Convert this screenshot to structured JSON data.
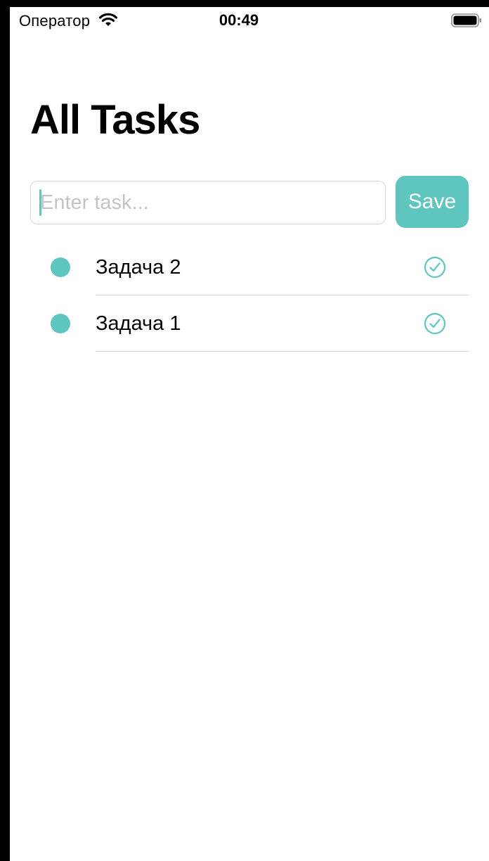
{
  "status_bar": {
    "carrier": "Оператор",
    "time": "00:49",
    "wifi_icon": "wifi-icon",
    "battery_icon": "battery-full-icon"
  },
  "header": {
    "title": "All Tasks"
  },
  "new_task": {
    "value": "",
    "placeholder": "Enter task...",
    "save_label": "Save"
  },
  "tasks": [
    {
      "label": "Задача 2",
      "bullet_icon": "dot-icon",
      "action_icon": "checkmark-circle-icon"
    },
    {
      "label": "Задача 1",
      "bullet_icon": "dot-icon",
      "action_icon": "checkmark-circle-icon"
    }
  ],
  "colors": {
    "accent": "#5ec6bf",
    "separator": "#d1d1d6",
    "input_border": "#d6d6d6",
    "placeholder": "#c4c4c6",
    "text": "#000000",
    "background": "#ffffff"
  }
}
